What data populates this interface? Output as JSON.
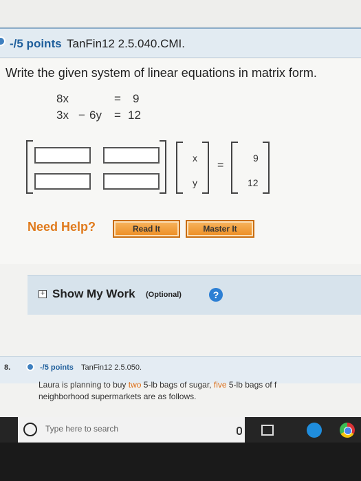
{
  "question_header": {
    "points": "-/5 points",
    "code": "TanFin12 2.5.040.CMI."
  },
  "prompt": "Write the given system of linear equations in matrix form.",
  "equations": {
    "row1": {
      "x": "8x",
      "op": "",
      "y": "",
      "eq": "=",
      "rhs": "9"
    },
    "row2": {
      "x": "3x",
      "op": "−",
      "y": "6y",
      "eq": "=",
      "rhs": "12"
    }
  },
  "matrix": {
    "variable_vector": [
      "x",
      "y"
    ],
    "equals": "=",
    "constant_vector": [
      "9",
      "12"
    ]
  },
  "help": {
    "label": "Need Help?",
    "read_it": "Read It",
    "master_it": "Master It"
  },
  "show_work": {
    "label": "Show My Work",
    "optional": "(Optional)",
    "help_icon": "?"
  },
  "next_question": {
    "number": "8.",
    "points": "-/5 points",
    "code": "TanFin12 2.5.050.",
    "line1_a": "Laura is planning to buy ",
    "line1_b": "two",
    "line1_c": " 5-lb bags of sugar, ",
    "line1_d": "five",
    "line1_e": " 5-lb bags of f",
    "line2": "neighborhood supermarkets are as follows."
  },
  "taskbar": {
    "search_placeholder": "Type here to search"
  },
  "colors": {
    "accent_blue": "#1f5f9c",
    "help_orange": "#e07a1c",
    "button_orange": "#ed8d22"
  }
}
